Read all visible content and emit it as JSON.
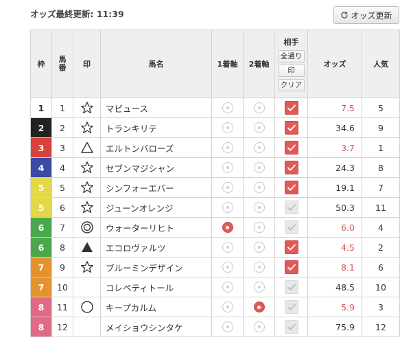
{
  "header": {
    "updated_label": "オッズ最終更新: 11:39",
    "refresh_label": "オッズ更新"
  },
  "columns": {
    "waku": "枠",
    "umaban": "馬\n番",
    "mark": "印",
    "name": "馬名",
    "first": "1着軸",
    "second": "2着軸",
    "aite": {
      "title": "相手",
      "all": "全通り",
      "mark": "印",
      "clear": "クリア"
    },
    "odds": "オッズ",
    "popularity": "人気"
  },
  "colors": {
    "hot_odds": "#d9534f",
    "accent": "#e05a57"
  },
  "horses": [
    {
      "waku": "1",
      "waku_bg": "#ffffff",
      "waku_fg": "#333333",
      "num": "1",
      "mark": "star",
      "name": "マピュース",
      "first": false,
      "second": false,
      "aite": true,
      "odds": "7.5",
      "hot": true,
      "pop": "5"
    },
    {
      "waku": "2",
      "waku_bg": "#222222",
      "waku_fg": "#ffffff",
      "num": "2",
      "mark": "star",
      "name": "トランキリテ",
      "first": false,
      "second": false,
      "aite": true,
      "odds": "34.6",
      "hot": false,
      "pop": "9"
    },
    {
      "waku": "3",
      "waku_bg": "#d9423c",
      "waku_fg": "#ffffff",
      "num": "3",
      "mark": "triangle-outline",
      "name": "エルトンバローズ",
      "first": false,
      "second": false,
      "aite": true,
      "odds": "3.7",
      "hot": true,
      "pop": "1"
    },
    {
      "waku": "4",
      "waku_bg": "#3a4aa6",
      "waku_fg": "#ffffff",
      "num": "4",
      "mark": "star",
      "name": "セブンマジシャン",
      "first": false,
      "second": false,
      "aite": true,
      "odds": "24.3",
      "hot": false,
      "pop": "8"
    },
    {
      "waku": "5",
      "waku_bg": "#e3d84a",
      "waku_fg": "#ffffff",
      "num": "5",
      "mark": "star",
      "name": "シンフォーエバー",
      "first": false,
      "second": false,
      "aite": true,
      "odds": "19.1",
      "hot": false,
      "pop": "7"
    },
    {
      "waku": "5",
      "waku_bg": "#e3d84a",
      "waku_fg": "#ffffff",
      "num": "6",
      "mark": "star",
      "name": "ジューンオレンジ",
      "first": false,
      "second": false,
      "aite": false,
      "odds": "50.3",
      "hot": false,
      "pop": "11"
    },
    {
      "waku": "6",
      "waku_bg": "#4aa84a",
      "waku_fg": "#ffffff",
      "num": "7",
      "mark": "double-circle",
      "name": "ウォーターリヒト",
      "first": true,
      "second": false,
      "aite": false,
      "odds": "6.0",
      "hot": true,
      "pop": "4"
    },
    {
      "waku": "6",
      "waku_bg": "#4aa84a",
      "waku_fg": "#ffffff",
      "num": "8",
      "mark": "triangle-filled",
      "name": "エコロヴァルツ",
      "first": false,
      "second": false,
      "aite": true,
      "odds": "4.5",
      "hot": true,
      "pop": "2"
    },
    {
      "waku": "7",
      "waku_bg": "#e5912e",
      "waku_fg": "#ffffff",
      "num": "9",
      "mark": "star",
      "name": "ブルーミンデザイン",
      "first": false,
      "second": false,
      "aite": true,
      "odds": "8.1",
      "hot": true,
      "pop": "6"
    },
    {
      "waku": "7",
      "waku_bg": "#e5912e",
      "waku_fg": "#ffffff",
      "num": "10",
      "mark": "none",
      "name": "コレペティトール",
      "first": false,
      "second": false,
      "aite": false,
      "odds": "48.5",
      "hot": false,
      "pop": "10"
    },
    {
      "waku": "8",
      "waku_bg": "#e06a86",
      "waku_fg": "#ffffff",
      "num": "11",
      "mark": "circle",
      "name": "キープカルム",
      "first": false,
      "second": true,
      "aite": false,
      "odds": "5.9",
      "hot": true,
      "pop": "3"
    },
    {
      "waku": "8",
      "waku_bg": "#e06a86",
      "waku_fg": "#ffffff",
      "num": "12",
      "mark": "none",
      "name": "メイショウシンタケ",
      "first": false,
      "second": false,
      "aite": false,
      "odds": "75.9",
      "hot": false,
      "pop": "12"
    }
  ]
}
